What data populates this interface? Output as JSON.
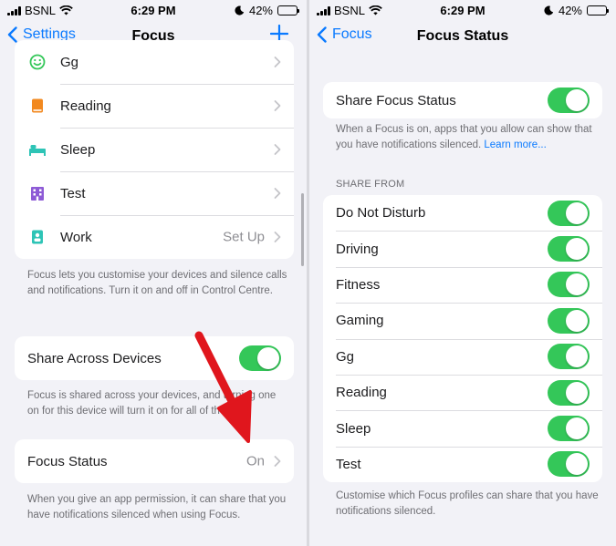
{
  "status_bar": {
    "carrier": "BSNL",
    "time": "6:29 PM",
    "battery": "42%"
  },
  "left": {
    "nav": {
      "back_label": "Settings",
      "title": "Focus"
    },
    "focus_list": [
      {
        "label": "Gg",
        "icon": "smiley-icon",
        "color": "#34c759"
      },
      {
        "label": "Reading",
        "icon": "book-icon",
        "color": "#f2891f"
      },
      {
        "label": "Sleep",
        "icon": "bed-icon",
        "color": "#2ec4b6"
      },
      {
        "label": "Test",
        "icon": "building-icon",
        "color": "#8e5bd6"
      },
      {
        "label": "Work",
        "icon": "id-badge-icon",
        "color": "#2ec4b6",
        "value": "Set Up"
      }
    ],
    "focus_note": "Focus lets you customise your devices and silence calls and notifications. Turn it on and off in Control Centre.",
    "share_across": {
      "label": "Share Across Devices",
      "on": true
    },
    "share_note": "Focus is shared across your devices, and turning one on for this device will turn it on for all of them.",
    "focus_status": {
      "label": "Focus Status",
      "value": "On"
    },
    "status_note": "When you give an app permission, it can share that you have notifications silenced when using Focus."
  },
  "right": {
    "nav": {
      "back_label": "Focus",
      "title": "Focus Status"
    },
    "share_status": {
      "label": "Share Focus Status",
      "on": true
    },
    "share_note": "When a Focus is on, apps that you allow can show that you have notifications silenced.",
    "learn_more": "Learn more...",
    "section_header": "SHARE FROM",
    "share_from": [
      {
        "label": "Do Not Disturb",
        "on": true
      },
      {
        "label": "Driving",
        "on": true
      },
      {
        "label": "Fitness",
        "on": true
      },
      {
        "label": "Gaming",
        "on": true
      },
      {
        "label": "Gg",
        "on": true
      },
      {
        "label": "Reading",
        "on": true
      },
      {
        "label": "Sleep",
        "on": true
      },
      {
        "label": "Test",
        "on": true
      }
    ],
    "bottom_note": "Customise which Focus profiles can share that you have notifications silenced."
  },
  "colors": {
    "accent": "#0a7aff",
    "toggle_on": "#34c759",
    "annotation_arrow": "#e0161d"
  }
}
